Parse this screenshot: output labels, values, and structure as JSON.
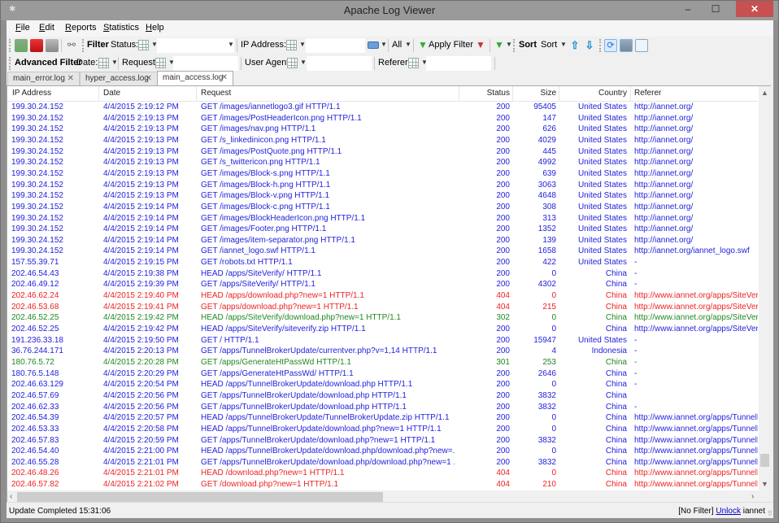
{
  "window": {
    "title": "Apache Log Viewer",
    "minimize": "–",
    "maximize": "☐",
    "close": "✕"
  },
  "menu": [
    "File",
    "Edit",
    "Reports",
    "Statistics",
    "Help"
  ],
  "toolbar1": {
    "filter_label": "Filter",
    "status_label": "Status:",
    "status_value": "",
    "ip_label": "IP Address:",
    "ip_value": "",
    "all_label": "All",
    "apply_filter": "Apply Filter",
    "sort_label": "Sort",
    "sort_select": "Sort"
  },
  "toolbar2": {
    "advanced_filter_label": "Advanced Filter",
    "date_label": "Date:",
    "request_label": "Request:",
    "request_value": "",
    "user_agent_label": "User Agent:",
    "user_agent_value": "",
    "referer_label": "Referer:",
    "referer_value": ""
  },
  "tabs": [
    {
      "label": "main_error.log",
      "active": false
    },
    {
      "label": "hyper_access.log",
      "active": false
    },
    {
      "label": "main_access.log",
      "active": true
    }
  ],
  "colors": {
    "ok": "#2222dd",
    "error": "#ee2222",
    "redirect": "#228822"
  },
  "table": {
    "columns": [
      "IP Address",
      "Date",
      "Request",
      "Status",
      "Size",
      "Country",
      "Referer"
    ],
    "rows": [
      {
        "ip": "199.30.24.152",
        "date": "4/4/2015 2:19:12 PM",
        "request": "GET /images/iannetlogo3.gif HTTP/1.1",
        "status": "200",
        "size": "95405",
        "country": "United States",
        "referer": "http://iannet.org/",
        "kind": "ok"
      },
      {
        "ip": "199.30.24.152",
        "date": "4/4/2015 2:19:13 PM",
        "request": "GET /images/PostHeaderIcon.png HTTP/1.1",
        "status": "200",
        "size": "147",
        "country": "United States",
        "referer": "http://iannet.org/",
        "kind": "ok"
      },
      {
        "ip": "199.30.24.152",
        "date": "4/4/2015 2:19:13 PM",
        "request": "GET /images/nav.png HTTP/1.1",
        "status": "200",
        "size": "626",
        "country": "United States",
        "referer": "http://iannet.org/",
        "kind": "ok"
      },
      {
        "ip": "199.30.24.152",
        "date": "4/4/2015 2:19:13 PM",
        "request": "GET /s_linkedinicon.png HTTP/1.1",
        "status": "200",
        "size": "4029",
        "country": "United States",
        "referer": "http://iannet.org/",
        "kind": "ok"
      },
      {
        "ip": "199.30.24.152",
        "date": "4/4/2015 2:19:13 PM",
        "request": "GET /images/PostQuote.png HTTP/1.1",
        "status": "200",
        "size": "445",
        "country": "United States",
        "referer": "http://iannet.org/",
        "kind": "ok"
      },
      {
        "ip": "199.30.24.152",
        "date": "4/4/2015 2:19:13 PM",
        "request": "GET /s_twittericon.png HTTP/1.1",
        "status": "200",
        "size": "4992",
        "country": "United States",
        "referer": "http://iannet.org/",
        "kind": "ok"
      },
      {
        "ip": "199.30.24.152",
        "date": "4/4/2015 2:19:13 PM",
        "request": "GET /images/Block-s.png HTTP/1.1",
        "status": "200",
        "size": "639",
        "country": "United States",
        "referer": "http://iannet.org/",
        "kind": "ok"
      },
      {
        "ip": "199.30.24.152",
        "date": "4/4/2015 2:19:13 PM",
        "request": "GET /images/Block-h.png HTTP/1.1",
        "status": "200",
        "size": "3063",
        "country": "United States",
        "referer": "http://iannet.org/",
        "kind": "ok"
      },
      {
        "ip": "199.30.24.152",
        "date": "4/4/2015 2:19:13 PM",
        "request": "GET /images/Block-v.png HTTP/1.1",
        "status": "200",
        "size": "4648",
        "country": "United States",
        "referer": "http://iannet.org/",
        "kind": "ok"
      },
      {
        "ip": "199.30.24.152",
        "date": "4/4/2015 2:19:14 PM",
        "request": "GET /images/Block-c.png HTTP/1.1",
        "status": "200",
        "size": "308",
        "country": "United States",
        "referer": "http://iannet.org/",
        "kind": "ok"
      },
      {
        "ip": "199.30.24.152",
        "date": "4/4/2015 2:19:14 PM",
        "request": "GET /images/BlockHeaderIcon.png HTTP/1.1",
        "status": "200",
        "size": "313",
        "country": "United States",
        "referer": "http://iannet.org/",
        "kind": "ok"
      },
      {
        "ip": "199.30.24.152",
        "date": "4/4/2015 2:19:14 PM",
        "request": "GET /images/Footer.png HTTP/1.1",
        "status": "200",
        "size": "1352",
        "country": "United States",
        "referer": "http://iannet.org/",
        "kind": "ok"
      },
      {
        "ip": "199.30.24.152",
        "date": "4/4/2015 2:19:14 PM",
        "request": "GET /images/item-separator.png HTTP/1.1",
        "status": "200",
        "size": "139",
        "country": "United States",
        "referer": "http://iannet.org/",
        "kind": "ok"
      },
      {
        "ip": "199.30.24.152",
        "date": "4/4/2015 2:19:14 PM",
        "request": "GET /iannet_logo.swf HTTP/1.1",
        "status": "200",
        "size": "1658",
        "country": "United States",
        "referer": "http://iannet.org/iannet_logo.swf",
        "kind": "ok"
      },
      {
        "ip": "157.55.39.71",
        "date": "4/4/2015 2:19:15 PM",
        "request": "GET /robots.txt HTTP/1.1",
        "status": "200",
        "size": "422",
        "country": "United States",
        "referer": "-",
        "kind": "ok"
      },
      {
        "ip": "202.46.54.43",
        "date": "4/4/2015 2:19:38 PM",
        "request": "HEAD /apps/SiteVerify/ HTTP/1.1",
        "status": "200",
        "size": "0",
        "country": "China",
        "referer": "-",
        "kind": "ok"
      },
      {
        "ip": "202.46.49.12",
        "date": "4/4/2015 2:19:39 PM",
        "request": "GET /apps/SiteVerify/ HTTP/1.1",
        "status": "200",
        "size": "4302",
        "country": "China",
        "referer": "-",
        "kind": "ok"
      },
      {
        "ip": "202.46.62.24",
        "date": "4/4/2015 2:19:40 PM",
        "request": "HEAD /apps/download.php?new=1 HTTP/1.1",
        "status": "404",
        "size": "0",
        "country": "China",
        "referer": "http://www.iannet.org/apps/SiteVerif",
        "kind": "error"
      },
      {
        "ip": "202.46.53.68",
        "date": "4/4/2015 2:19:41 PM",
        "request": "GET /apps/download.php?new=1 HTTP/1.1",
        "status": "404",
        "size": "215",
        "country": "China",
        "referer": "http://www.iannet.org/apps/SiteVerif",
        "kind": "error"
      },
      {
        "ip": "202.46.52.25",
        "date": "4/4/2015 2:19:42 PM",
        "request": "HEAD /apps/SiteVerify/download.php?new=1 HTTP/1.1",
        "status": "302",
        "size": "0",
        "country": "China",
        "referer": "http://www.iannet.org/apps/SiteVerif",
        "kind": "redirect"
      },
      {
        "ip": "202.46.52.25",
        "date": "4/4/2015 2:19:42 PM",
        "request": "HEAD /apps/SiteVerify/siteverify.zip HTTP/1.1",
        "status": "200",
        "size": "0",
        "country": "China",
        "referer": "http://www.iannet.org/apps/SiteVerif",
        "kind": "ok"
      },
      {
        "ip": "191.236.33.18",
        "date": "4/4/2015 2:19:50 PM",
        "request": "GET / HTTP/1.1",
        "status": "200",
        "size": "15947",
        "country": "United States",
        "referer": "-",
        "kind": "ok"
      },
      {
        "ip": "36.76.244.171",
        "date": "4/4/2015 2:20:13 PM",
        "request": "GET /apps/TunnelBrokerUpdate/currentver.php?v=1,14 HTTP/1.1",
        "status": "200",
        "size": "4",
        "country": "Indonesia",
        "referer": "-",
        "kind": "ok"
      },
      {
        "ip": "180.76.5.72",
        "date": "4/4/2015 2:20:28 PM",
        "request": "GET /apps/GenerateHtPassWd HTTP/1.1",
        "status": "301",
        "size": "253",
        "country": "China",
        "referer": "-",
        "kind": "redirect"
      },
      {
        "ip": "180.76.5.148",
        "date": "4/4/2015 2:20:29 PM",
        "request": "GET /apps/GenerateHtPassWd/ HTTP/1.1",
        "status": "200",
        "size": "2646",
        "country": "China",
        "referer": "-",
        "kind": "ok"
      },
      {
        "ip": "202.46.63.129",
        "date": "4/4/2015 2:20:54 PM",
        "request": "HEAD /apps/TunnelBrokerUpdate/download.php HTTP/1.1",
        "status": "200",
        "size": "0",
        "country": "China",
        "referer": "-",
        "kind": "ok"
      },
      {
        "ip": "202.46.57.69",
        "date": "4/4/2015 2:20:56 PM",
        "request": "GET /apps/TunnelBrokerUpdate/download.php HTTP/1.1",
        "status": "200",
        "size": "3832",
        "country": "China",
        "referer": "",
        "kind": "ok"
      },
      {
        "ip": "202.46.62.33",
        "date": "4/4/2015 2:20:56 PM",
        "request": "GET /apps/TunnelBrokerUpdate/download.php HTTP/1.1",
        "status": "200",
        "size": "3832",
        "country": "China",
        "referer": "-",
        "kind": "ok"
      },
      {
        "ip": "202.46.54.39",
        "date": "4/4/2015 2:20:57 PM",
        "request": "HEAD /apps/TunnelBrokerUpdate/TunnelBrokerUpdate.zip HTTP/1.1",
        "status": "200",
        "size": "0",
        "country": "China",
        "referer": "http://www.iannet.org/apps/TunnelB",
        "kind": "ok"
      },
      {
        "ip": "202.46.53.33",
        "date": "4/4/2015 2:20:58 PM",
        "request": "HEAD /apps/TunnelBrokerUpdate/download.php?new=1 HTTP/1.1",
        "status": "200",
        "size": "0",
        "country": "China",
        "referer": "http://www.iannet.org/apps/TunnelB",
        "kind": "ok"
      },
      {
        "ip": "202.46.57.83",
        "date": "4/4/2015 2:20:59 PM",
        "request": "GET /apps/TunnelBrokerUpdate/download.php?new=1 HTTP/1.1",
        "status": "200",
        "size": "3832",
        "country": "China",
        "referer": "http://www.iannet.org/apps/TunnelB",
        "kind": "ok"
      },
      {
        "ip": "202.46.54.40",
        "date": "4/4/2015 2:21:00 PM",
        "request": "HEAD /apps/TunnelBrokerUpdate/download.php/download.php?new=...",
        "status": "200",
        "size": "0",
        "country": "China",
        "referer": "http://www.iannet.org/apps/TunnelB",
        "kind": "ok"
      },
      {
        "ip": "202.46.55.28",
        "date": "4/4/2015 2:21:01 PM",
        "request": "GET /apps/TunnelBrokerUpdate/download.php/download.php?new=1 ...",
        "status": "200",
        "size": "3832",
        "country": "China",
        "referer": "http://www.iannet.org/apps/TunnelB",
        "kind": "ok"
      },
      {
        "ip": "202.46.48.26",
        "date": "4/4/2015 2:21:01 PM",
        "request": "HEAD /download.php?new=1 HTTP/1.1",
        "status": "404",
        "size": "0",
        "country": "China",
        "referer": "http://www.iannet.org/apps/TunnelB",
        "kind": "error"
      },
      {
        "ip": "202.46.57.82",
        "date": "4/4/2015 2:21:02 PM",
        "request": "GET /download.php?new=1 HTTP/1.1",
        "status": "404",
        "size": "210",
        "country": "China",
        "referer": "http://www.iannet.org/apps/TunnelB",
        "kind": "error"
      }
    ]
  },
  "statusbar": {
    "message": "Update Completed 15:31:06",
    "filter_state": "[No Filter]",
    "unlock_link": "Unlock",
    "user": "iannet"
  }
}
